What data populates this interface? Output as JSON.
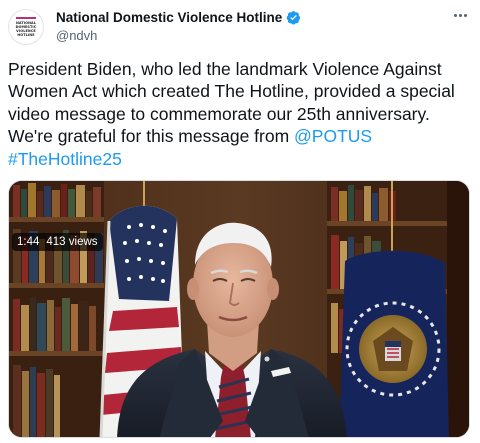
{
  "account": {
    "display_name": "National Domestic Violence Hotline",
    "handle": "@ndvh",
    "verified": true,
    "avatar_logo_lines": [
      "NATIONAL",
      "DOMESTIC",
      "VIOLENCE",
      "HOTLINE"
    ]
  },
  "tweet": {
    "text": "President Biden, who led the landmark Violence Against Women Act which created The Hotline, provided a special video message to commemorate our 25th anniversary. We're grateful for this message from ",
    "mention": "@POTUS",
    "hashtag": "#TheHotline25"
  },
  "video": {
    "duration": "1:44",
    "views": "413 views"
  },
  "icons": {
    "verified": "verified-badge-icon",
    "more": "more-options-icon"
  },
  "colors": {
    "link": "#1d9bf0",
    "verified": "#1d9bf0",
    "text": "#0f1419",
    "secondary": "#536471"
  }
}
